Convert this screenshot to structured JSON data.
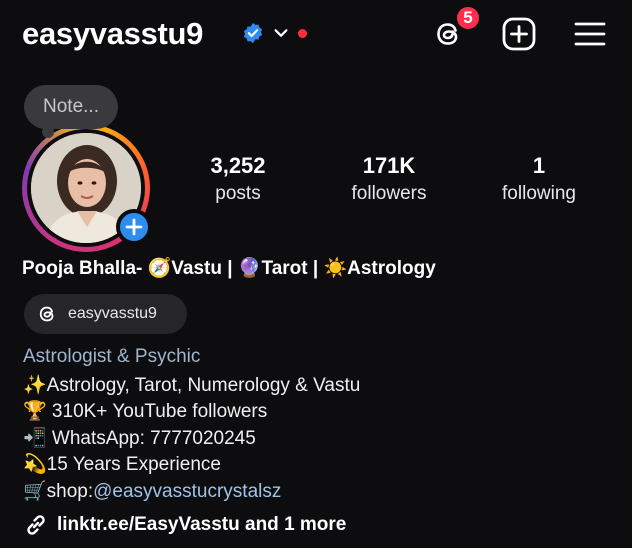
{
  "header": {
    "username": "easyvasstu9",
    "notification_count": "5"
  },
  "note": {
    "placeholder": "Note..."
  },
  "stats": [
    {
      "value": "3,252",
      "label": "posts"
    },
    {
      "value": "171K",
      "label": "followers"
    },
    {
      "value": "1",
      "label": "following"
    }
  ],
  "profile": {
    "full_name": "Pooja Bhalla- 🧭Vastu | 🔮Tarot | ☀️Astrology",
    "threads_handle": "easyvasstu9",
    "category": "Astrologist & Psychic",
    "bio_lines": [
      "✨Astrology, Tarot, Numerology & Vastu",
      "🏆 310K+ YouTube followers",
      "📲 WhatsApp: 7777020245",
      "💫15 Years Experience"
    ],
    "shop_prefix": "🛒shop:",
    "shop_handle": "@easyvasstucrystalsz",
    "links_text": "linktr.ee/EasyVasstu and 1 more"
  },
  "icons": {
    "verified": "verified-badge-icon",
    "threads": "threads-icon",
    "create": "plus-square-icon",
    "menu": "hamburger-menu-icon",
    "link": "link-icon"
  },
  "colors": {
    "background": "#0d0d0f",
    "verified": "#2e8bf0",
    "badge": "#ff2e4d",
    "category": "#9fb6cf"
  }
}
